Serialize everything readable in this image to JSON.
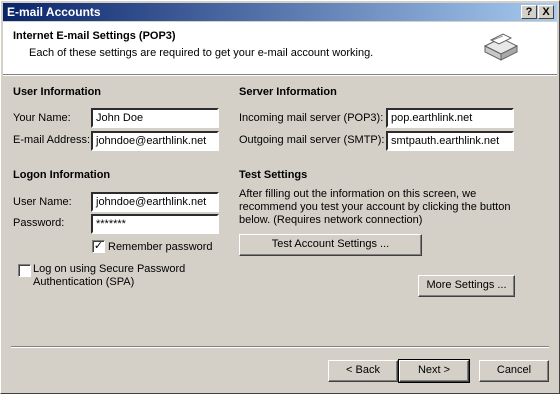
{
  "window": {
    "title": "E-mail Accounts",
    "help_label": "?",
    "close_label": "X"
  },
  "header": {
    "title": "Internet E-mail Settings (POP3)",
    "subtitle": "Each of these settings are required to get your e-mail account working."
  },
  "user_info": {
    "heading": "User Information",
    "name_label": "Your Name:",
    "name_value": "John Doe",
    "email_label": "E-mail Address:",
    "email_value": "johndoe@earthlink.net"
  },
  "server_info": {
    "heading": "Server Information",
    "incoming_label": "Incoming mail server (POP3):",
    "incoming_value": "pop.earthlink.net",
    "outgoing_label": "Outgoing mail server (SMTP):",
    "outgoing_value": "smtpauth.earthlink.net"
  },
  "logon_info": {
    "heading": "Logon Information",
    "username_label": "User Name:",
    "username_value": "johndoe@earthlink.net",
    "password_label": "Password:",
    "password_value": "*******",
    "remember_label": "Remember password",
    "remember_checked": true,
    "spa_label_line1": "Log on using Secure Password",
    "spa_label_line2": "Authentication (SPA)",
    "spa_checked": false
  },
  "test_settings": {
    "heading": "Test Settings",
    "description_line1": "After filling out the information on this screen, we",
    "description_line2": "recommend you test your account by clicking the button",
    "description_line3": "below. (Requires network connection)",
    "test_button": "Test Account Settings ..."
  },
  "more_settings_button": "More Settings ...",
  "footer": {
    "back_button": "< Back",
    "next_button": "Next >",
    "cancel_button": "Cancel"
  },
  "icons": {
    "header_icon": "mailbox-envelope-icon"
  }
}
